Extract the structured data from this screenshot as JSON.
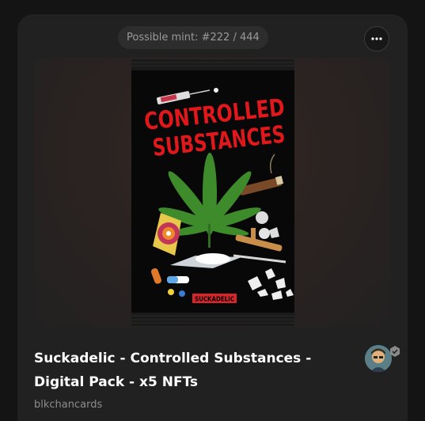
{
  "mint": {
    "label": "Possible mint: #222 / 444"
  },
  "menu": {
    "icon": "more-horizontal-icon"
  },
  "artwork": {
    "headline_line1": "CONTROLLED",
    "headline_line2": "SUBSTANCES",
    "brand": "SUCKADELIC"
  },
  "nft": {
    "title": "Suckadelic - Controlled Substances - Digital Pack - x5 NFTs",
    "creator": "blkchancards"
  },
  "icons": {
    "avatar": "creator-avatar",
    "verified": "verified-badge-icon"
  },
  "colors": {
    "card": "#212121",
    "page": "#141414",
    "headline_red": "#e0181c",
    "leaf_green": "#3d8b2a"
  }
}
